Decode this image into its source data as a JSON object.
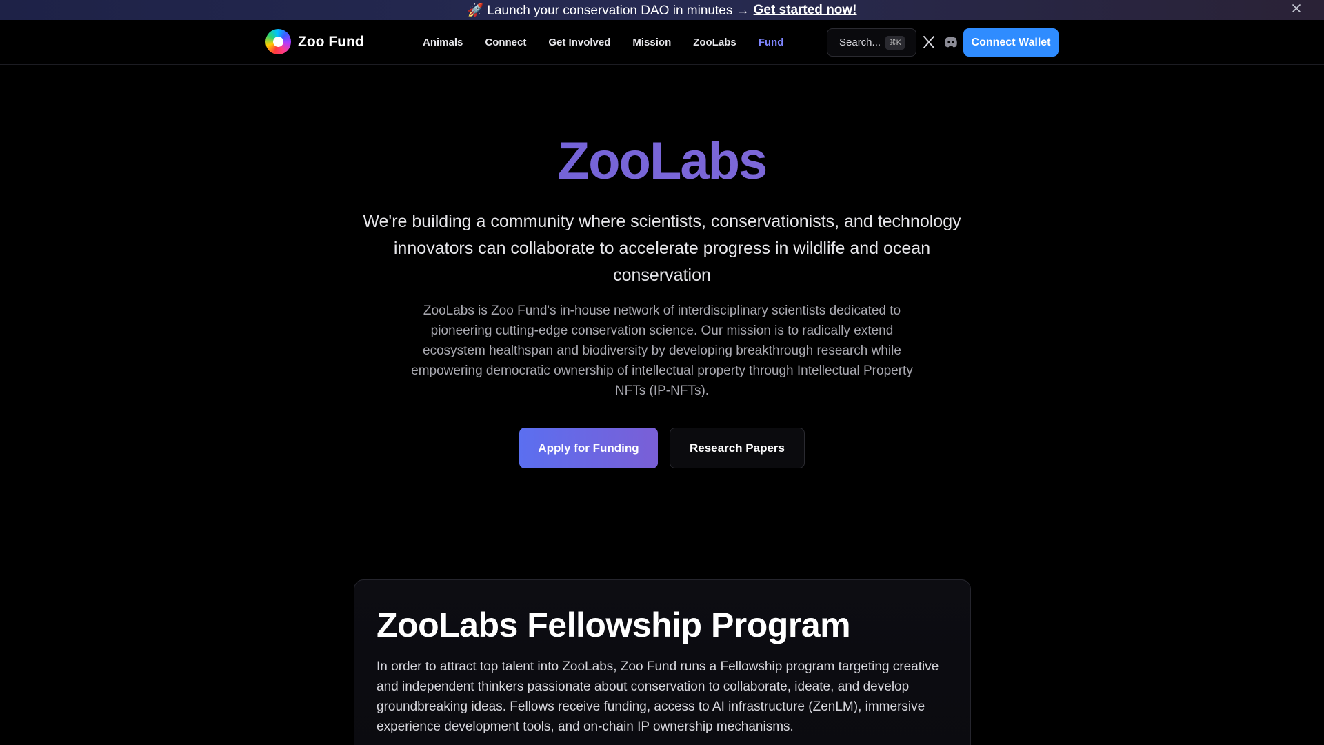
{
  "announcement": {
    "text": "🚀 Launch your conservation DAO in minutes → ",
    "cta": "Get started now!",
    "close_icon": "close-icon"
  },
  "nav": {
    "brand": "Zoo Fund",
    "links": [
      "Animals",
      "Connect",
      "Get Involved",
      "Mission",
      "ZooLabs",
      "Fund"
    ],
    "active_link": "Fund",
    "search_placeholder": "Search...",
    "search_shortcut": "⌘K",
    "social_icons": [
      "x-icon",
      "discord-icon"
    ],
    "connect_wallet": "Connect Wallet",
    "colors": {
      "active": "#7f86ff",
      "wallet": "#2f8cff"
    }
  },
  "hero": {
    "title": "ZooLabs",
    "lead": "We're building a community where scientists, conservationists, and technology innovators can collaborate to accelerate progress in wildlife and ocean conservation",
    "body": "ZooLabs is Zoo Fund's in-house network of interdisciplinary scientists dedicated to pioneering cutting-edge conservation science. Our mission is to radically extend ecosystem healthspan and biodiversity by developing breakthrough research while empowering democratic ownership of intellectual property through Intellectual Property NFTs (IP-NFTs).",
    "primary_button": "Apply for Funding",
    "secondary_button": "Research Papers"
  },
  "fellowship": {
    "title": "ZooLabs Fellowship Program",
    "body": "In order to attract top talent into ZooLabs, Zoo Fund runs a Fellowship program targeting creative and independent thinkers passionate about conservation to collaborate, ideate, and develop groundbreaking ideas. Fellows receive funding, access to AI infrastructure (ZenLM), immersive experience development tools, and on-chain IP ownership mechanisms."
  }
}
